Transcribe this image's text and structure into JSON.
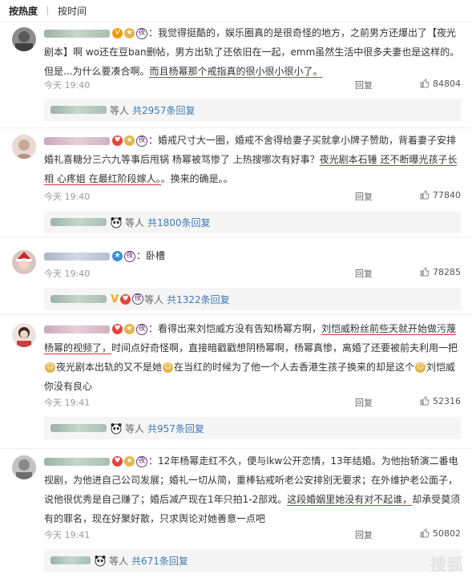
{
  "sort": {
    "hot": "按热度",
    "time": "按时间"
  },
  "reply_label": "回复",
  "sub_prefix": "等人",
  "comments": [
    {
      "text_before": "：我觉得挺酷的，娱乐圈真的是很奇怪的地方，之前男方还爆出了【夜光剧本】啊 wo还在豆ban删帖，男方出轨了还依旧在一起，emm虽然生活中很多夫妻也是这样的。但是...为什么要凑合啊。",
      "text_ul": "而且杨幂那个戒指真的很小很小很小了。",
      "time": "今天 19:40",
      "likes": "84804",
      "sub_more": "共2957条回复"
    },
    {
      "text_before": "：婚戒尺寸大一圈，婚戒不舍得给妻子买就拿小牌子赞助，背着妻子安排婚礼喜糖分三六九等事后甩锅 杨幂被骂惨了 上热搜哪次有好事？",
      "text_ul": "夜光剧本石锤 还不断曝光孩子长相 心疼姐 在最红阶段嫁人。",
      "text_after": "。换来的确是。。",
      "time": "今天 19:40",
      "likes": "77840",
      "sub_more": "共1800条回复"
    },
    {
      "text_before": "：卧槽",
      "time": "今天 19:40",
      "likes": "78285",
      "sub_more": "共1322条回复"
    },
    {
      "text_before": "：看得出来刘恺威方没有告知杨幂方啊，",
      "text_ul": "刘恺威粉丝前些天就开始做污蔑杨幂的视频了，",
      "text_after": "时间点好奇怪啊，直接暗戳戳想阴杨幂啊，杨幂真惨，离婚了还要被前夫利用一把",
      "text_after2": "夜光剧本出轨的又不是她",
      "text_after3": "在当红的时候为了他一个人去香港生孩子换来的却是这个",
      "text_after4": "刘恺威你没有良心",
      "time": "今天 19:41",
      "likes": "52316",
      "sub_more": "共957条回复"
    },
    {
      "text_before": "：12年杨幂走红不久，便与lkw公开恋情，13年结婚。为他抬轿演二番电视剧，为他进自己公司发展；婚礼一切从简，重棒钻戒听老公安排别无要求；在外维护老公面子，说他很优秀是自己赚了；婚后减产现在1年只拍1-2部戏。",
      "text_ul": "这段婚姻里她没有对不起谁，",
      "text_after": "却承受莫须有的罪名，现在好聚好散，只求舆论对她善意一点吧",
      "time": "今天 19:41",
      "likes": "50802",
      "sub_more": "共671条回复"
    }
  ],
  "watermark": "搜狐"
}
